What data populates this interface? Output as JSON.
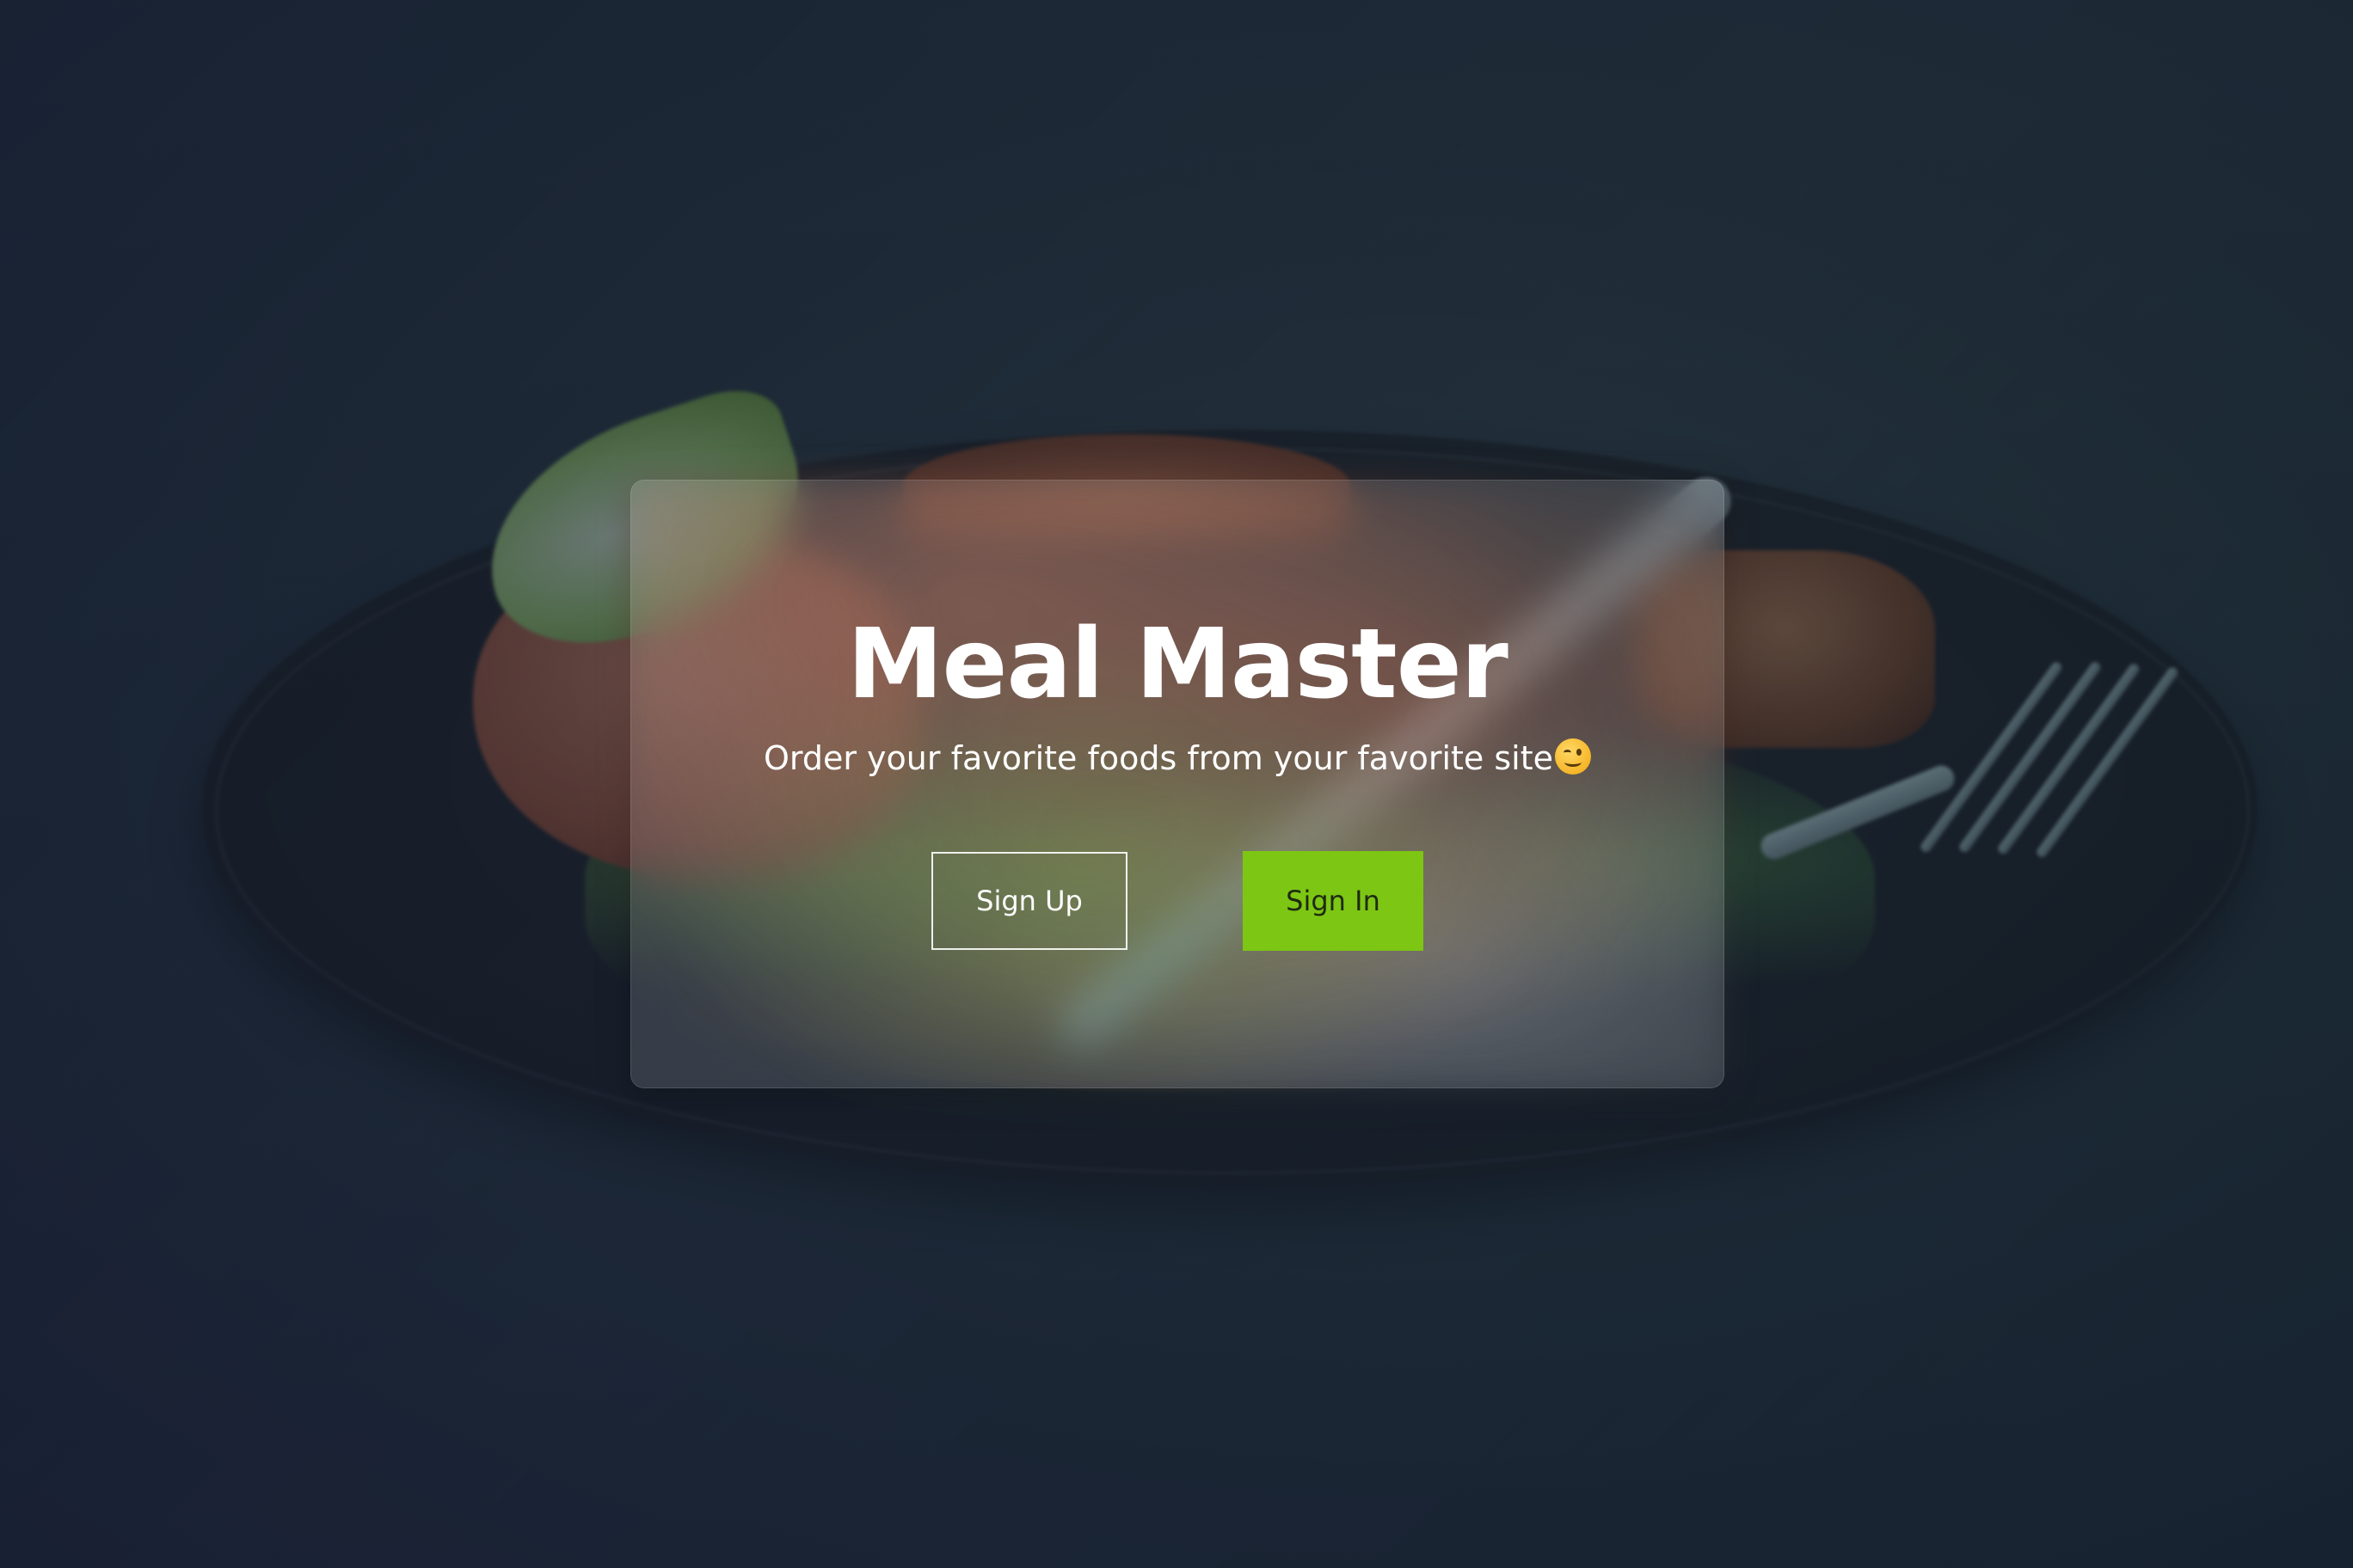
{
  "hero": {
    "title": "Meal Master",
    "subtitle": "Order your favorite foods from your favorite site",
    "subtitle_icon": "winking-face-icon"
  },
  "actions": {
    "sign_up_label": "Sign Up",
    "sign_in_label": "Sign In"
  },
  "colors": {
    "accent": "#7dc614",
    "text": "#ffffff",
    "overlay_start": "#1e285a",
    "overlay_end": "#145a3c"
  },
  "background": {
    "icon": "food-plate-photo"
  }
}
